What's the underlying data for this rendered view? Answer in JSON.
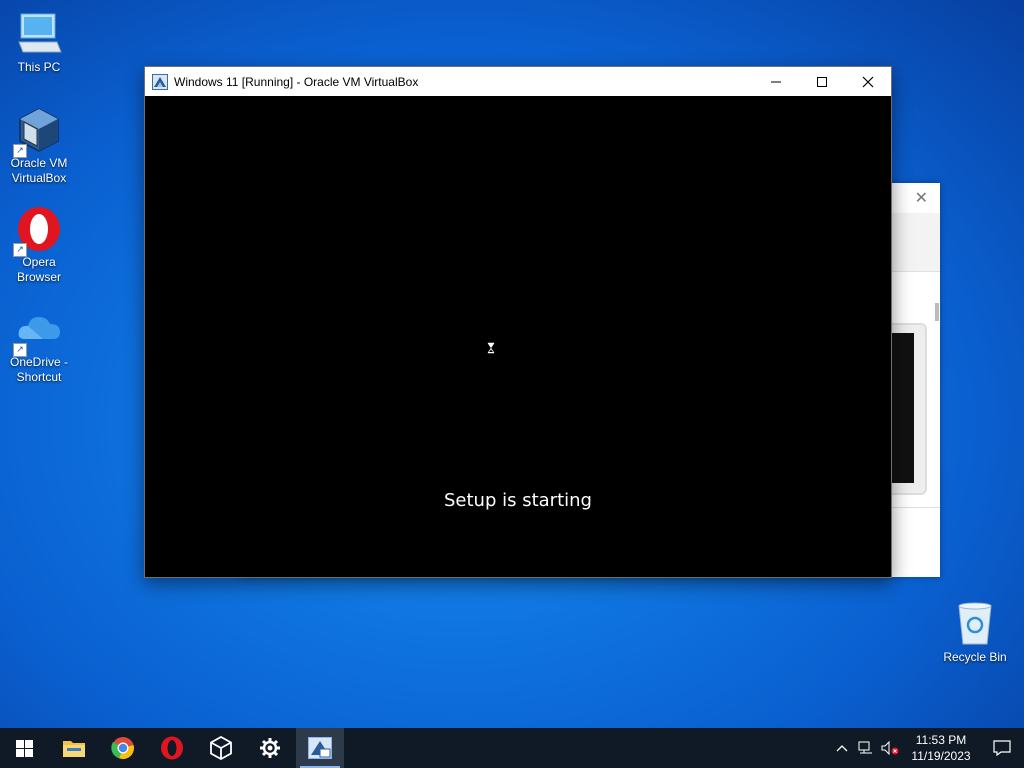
{
  "desktop": {
    "icons": [
      {
        "label": "This PC"
      },
      {
        "label": "Oracle VM VirtualBox"
      },
      {
        "label": "Opera Browser"
      },
      {
        "label": "OneDrive - Shortcut"
      }
    ],
    "recycle_bin": {
      "label": "Recycle Bin"
    }
  },
  "vbox_window": {
    "title": "Windows 11 [Running] - Oracle VM VirtualBox",
    "setup_text": "Setup is starting"
  },
  "taskbar": {
    "apps": [
      "start-icon",
      "file-explorer-icon",
      "chrome-icon",
      "opera-icon",
      "virtualbox-icon",
      "settings-icon",
      "virtualbox-vm-icon"
    ],
    "clock": {
      "time": "11:53 PM",
      "date": "11/19/2023"
    }
  },
  "colors": {
    "taskbar": "#101a27",
    "desktop": "#0f74e0"
  }
}
